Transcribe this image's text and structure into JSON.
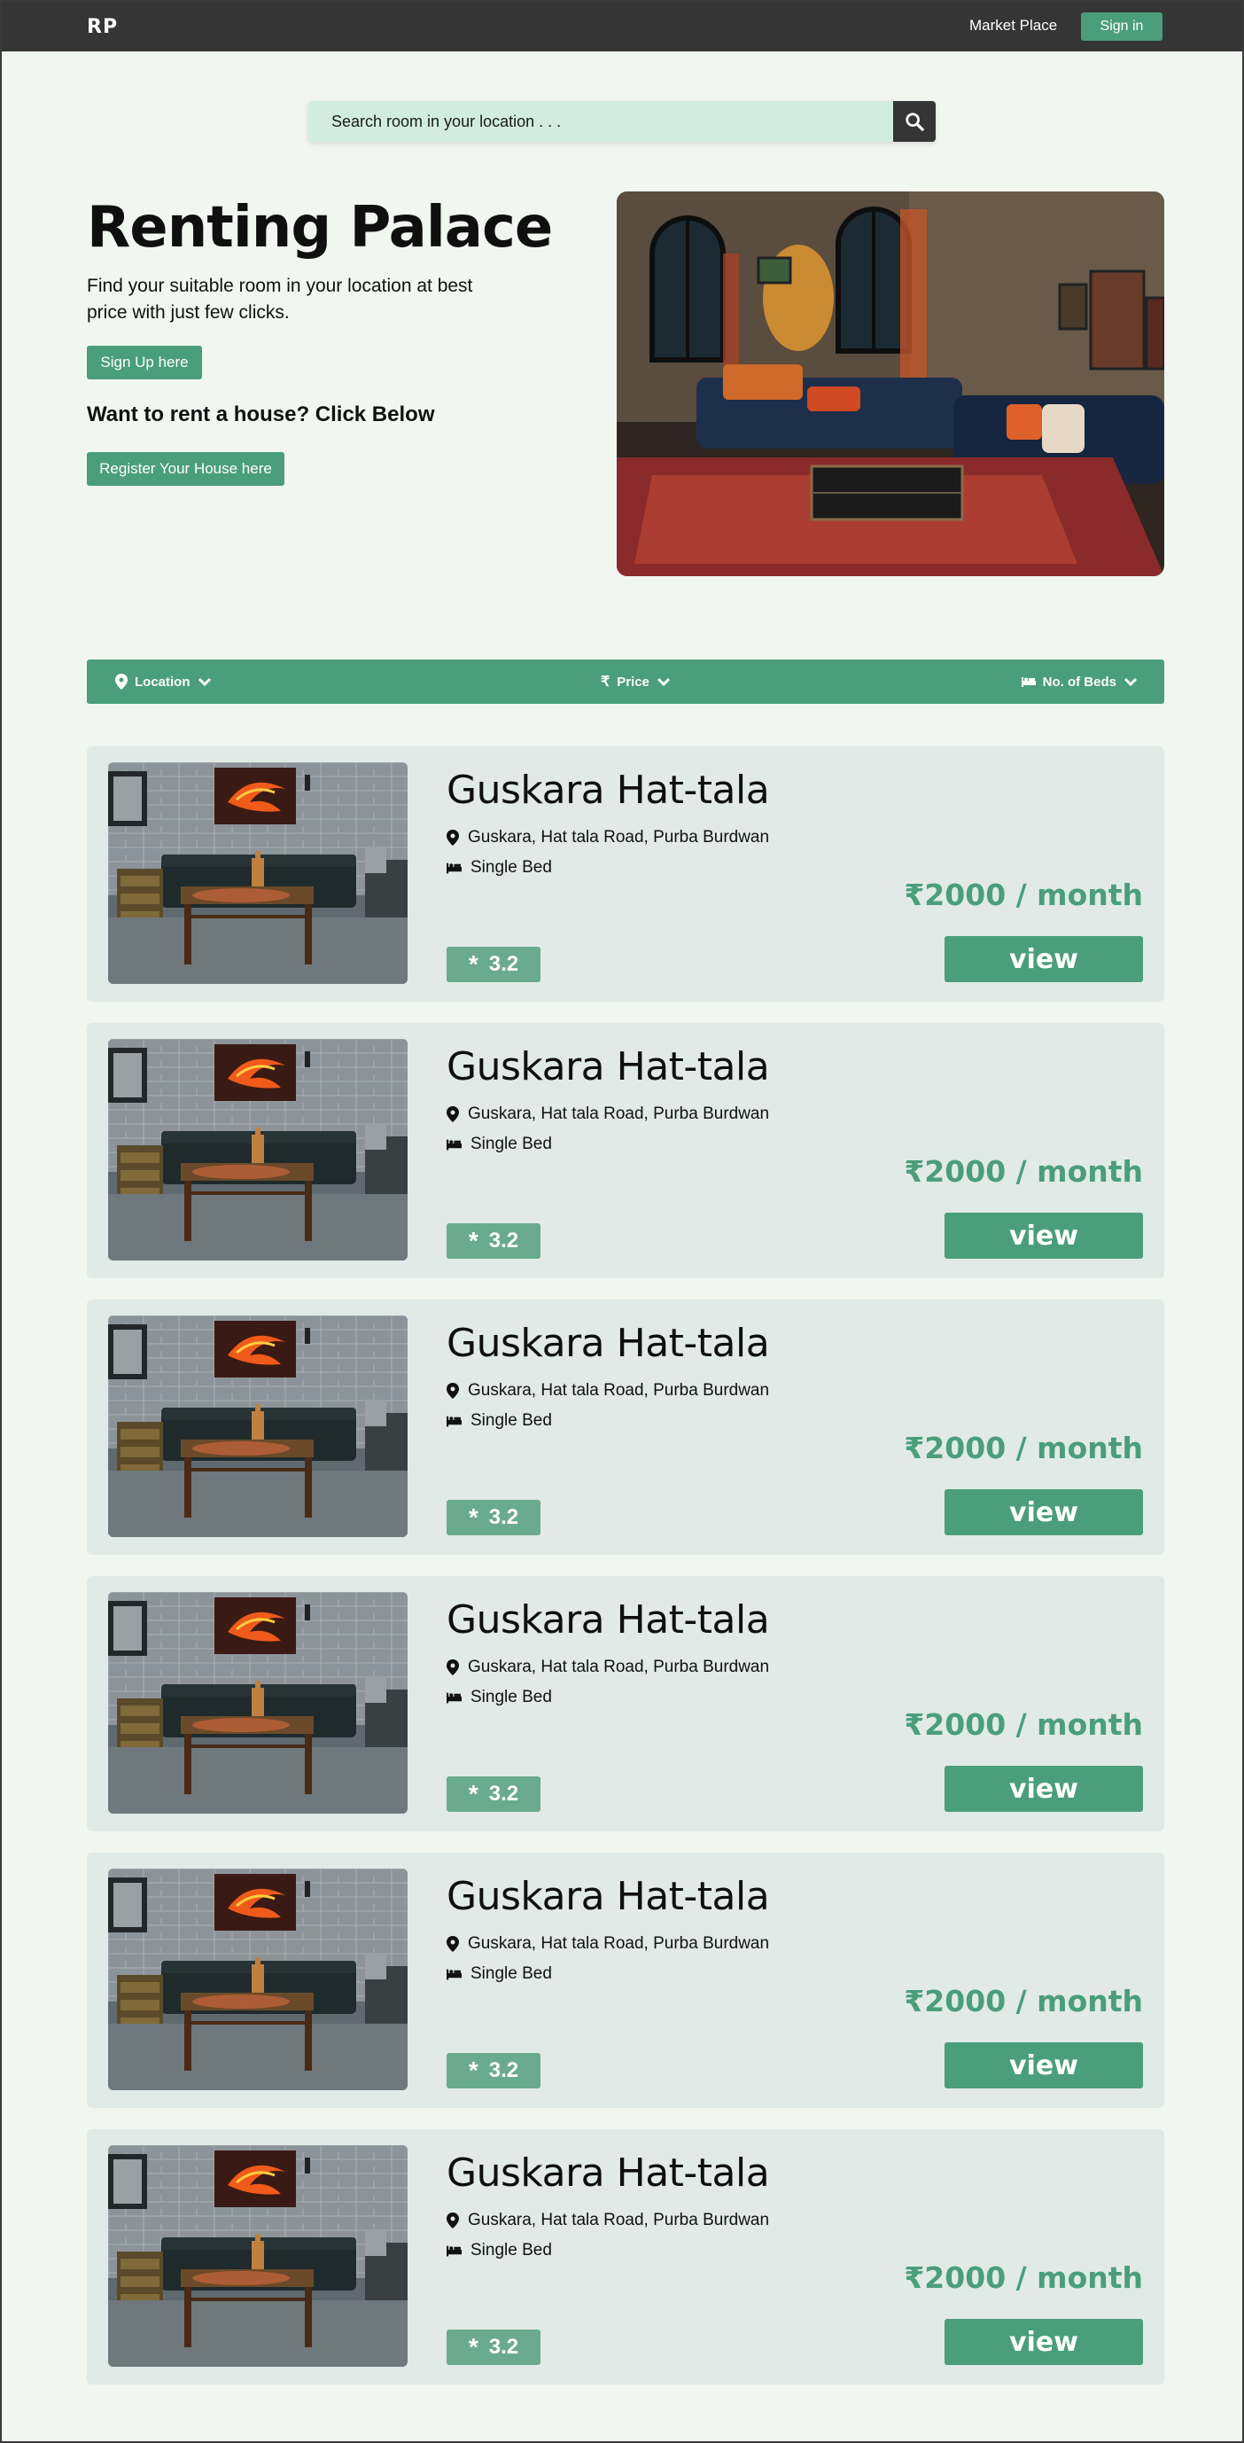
{
  "nav": {
    "logo": "RP",
    "market_place": "Market Place",
    "sign_in": "Sign in"
  },
  "search": {
    "placeholder": "Search room in your location . . ."
  },
  "hero": {
    "title": "Renting Palace",
    "text": "Find your suitable room in your location at best price with just few clicks.",
    "signup_label": "Sign Up here",
    "subtitle": "Want to rent a house? Click Below",
    "register_label": "Register Your House here"
  },
  "filters": {
    "location": "Location",
    "price": "Price",
    "beds": "No. of Beds"
  },
  "listings": [
    {
      "title": "Guskara Hat-tala",
      "location": "Guskara, Hat tala Road, Purba Burdwan",
      "beds": "Single Bed",
      "price": "₹2000 / month",
      "rating": "3.2",
      "view": "view"
    },
    {
      "title": "Guskara Hat-tala",
      "location": "Guskara, Hat tala Road, Purba Burdwan",
      "beds": "Single Bed",
      "price": "₹2000 / month",
      "rating": "3.2",
      "view": "view"
    },
    {
      "title": "Guskara Hat-tala",
      "location": "Guskara, Hat tala Road, Purba Burdwan",
      "beds": "Single Bed",
      "price": "₹2000 / month",
      "rating": "3.2",
      "view": "view"
    },
    {
      "title": "Guskara Hat-tala",
      "location": "Guskara, Hat tala Road, Purba Burdwan",
      "beds": "Single Bed",
      "price": "₹2000 / month",
      "rating": "3.2",
      "view": "view"
    },
    {
      "title": "Guskara Hat-tala",
      "location": "Guskara, Hat tala Road, Purba Burdwan",
      "beds": "Single Bed",
      "price": "₹2000 / month",
      "rating": "3.2",
      "view": "view"
    },
    {
      "title": "Guskara Hat-tala",
      "location": "Guskara, Hat tala Road, Purba Burdwan",
      "beds": "Single Bed",
      "price": "₹2000 / month",
      "rating": "3.2",
      "view": "view"
    }
  ],
  "colors": {
    "accent": "#4a9e7c",
    "navbar": "#353535",
    "background": "#f1f6f1",
    "card": "#e1eae6",
    "search_bg": "#d2eddf"
  },
  "icons": [
    "search-icon",
    "map-pin-icon",
    "rupee-icon",
    "bed-icon",
    "chevron-down-icon",
    "star-icon"
  ]
}
